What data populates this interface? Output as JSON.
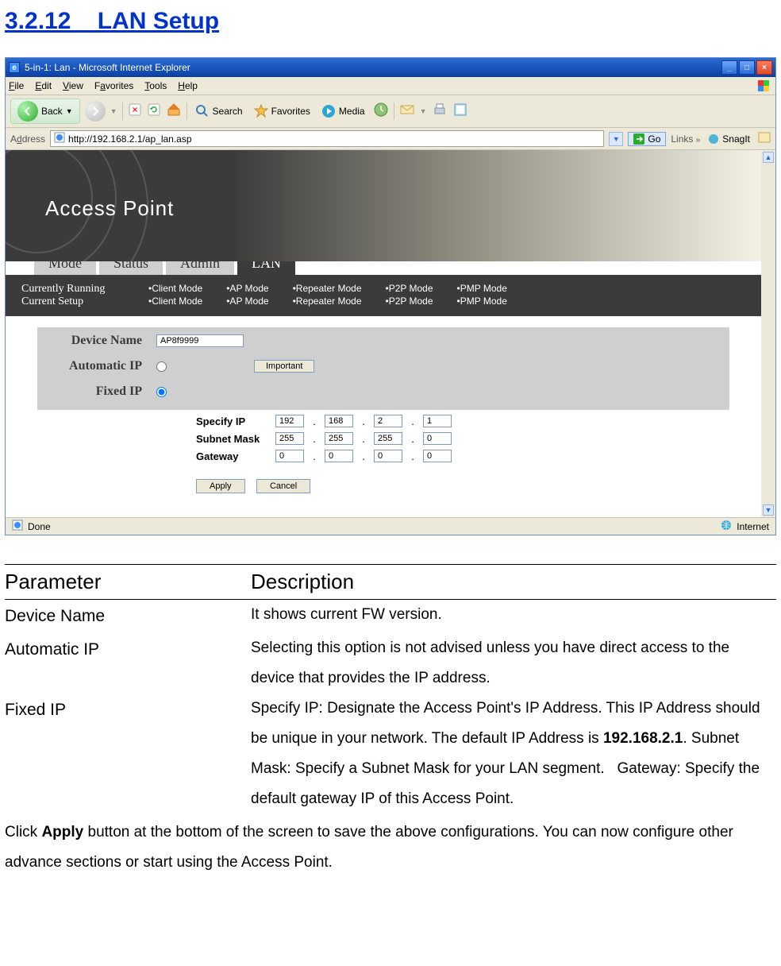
{
  "section_title": "3.2.12    LAN Setup",
  "window_title": "5-in-1: Lan - Microsoft Internet Explorer",
  "menu": {
    "file": "File",
    "edit": "Edit",
    "view": "View",
    "favorites": "Favorites",
    "tools": "Tools",
    "help": "Help"
  },
  "toolbar": {
    "back": "Back",
    "search": "Search",
    "favorites": "Favorites",
    "media": "Media"
  },
  "address": {
    "label": "Address",
    "url": "http://192.168.2.1/ap_lan.asp",
    "go": "Go",
    "links": "Links",
    "snagit": "SnagIt"
  },
  "hero_title": "Access Point",
  "tabs": {
    "mode": "Mode",
    "status": "Status",
    "admin": "Admin",
    "lan": "LAN"
  },
  "modes": {
    "running_label": "Currently Running",
    "setup_label": "Current Setup",
    "items": [
      "•Client Mode",
      "•AP Mode",
      "•Repeater Mode",
      "•P2P Mode",
      "•PMP Mode"
    ]
  },
  "form": {
    "device_name_label": "Device Name",
    "device_name_value": "AP8f9999",
    "automatic_ip_label": "Automatic IP",
    "fixed_ip_label": "Fixed IP",
    "important_btn": "Important",
    "specify_ip_label": "Specify IP",
    "subnet_mask_label": "Subnet Mask",
    "gateway_label": "Gateway",
    "ip": {
      "a": "192",
      "b": "168",
      "c": "2",
      "d": "1"
    },
    "mask": {
      "a": "255",
      "b": "255",
      "c": "255",
      "d": "0"
    },
    "gw": {
      "a": "0",
      "b": "0",
      "c": "0",
      "d": "0"
    },
    "apply": "Apply",
    "cancel": "Cancel"
  },
  "status": {
    "done": "Done",
    "zone": "Internet"
  },
  "table": {
    "header_param": "Parameter",
    "header_desc": "Description",
    "rows": [
      {
        "param": "Device Name",
        "desc": "It shows current FW version."
      },
      {
        "param": "Automatic IP",
        "desc": "Selecting this option is not advised unless you have direct access to the device that provides the IP address."
      },
      {
        "param": "Fixed IP",
        "desc": "Specify IP: Designate the Access Point's IP Address. This IP Address should be unique in your network. The default IP Address is 192.168.2.1. Subnet Mask: Specify a Subnet Mask for your LAN segment.   Gateway: Specify the default gateway IP of this Access Point."
      }
    ],
    "footer": "Click Apply button at the bottom of the screen to save the above configurations. You can now configure other advance sections or start using the Access Point."
  }
}
